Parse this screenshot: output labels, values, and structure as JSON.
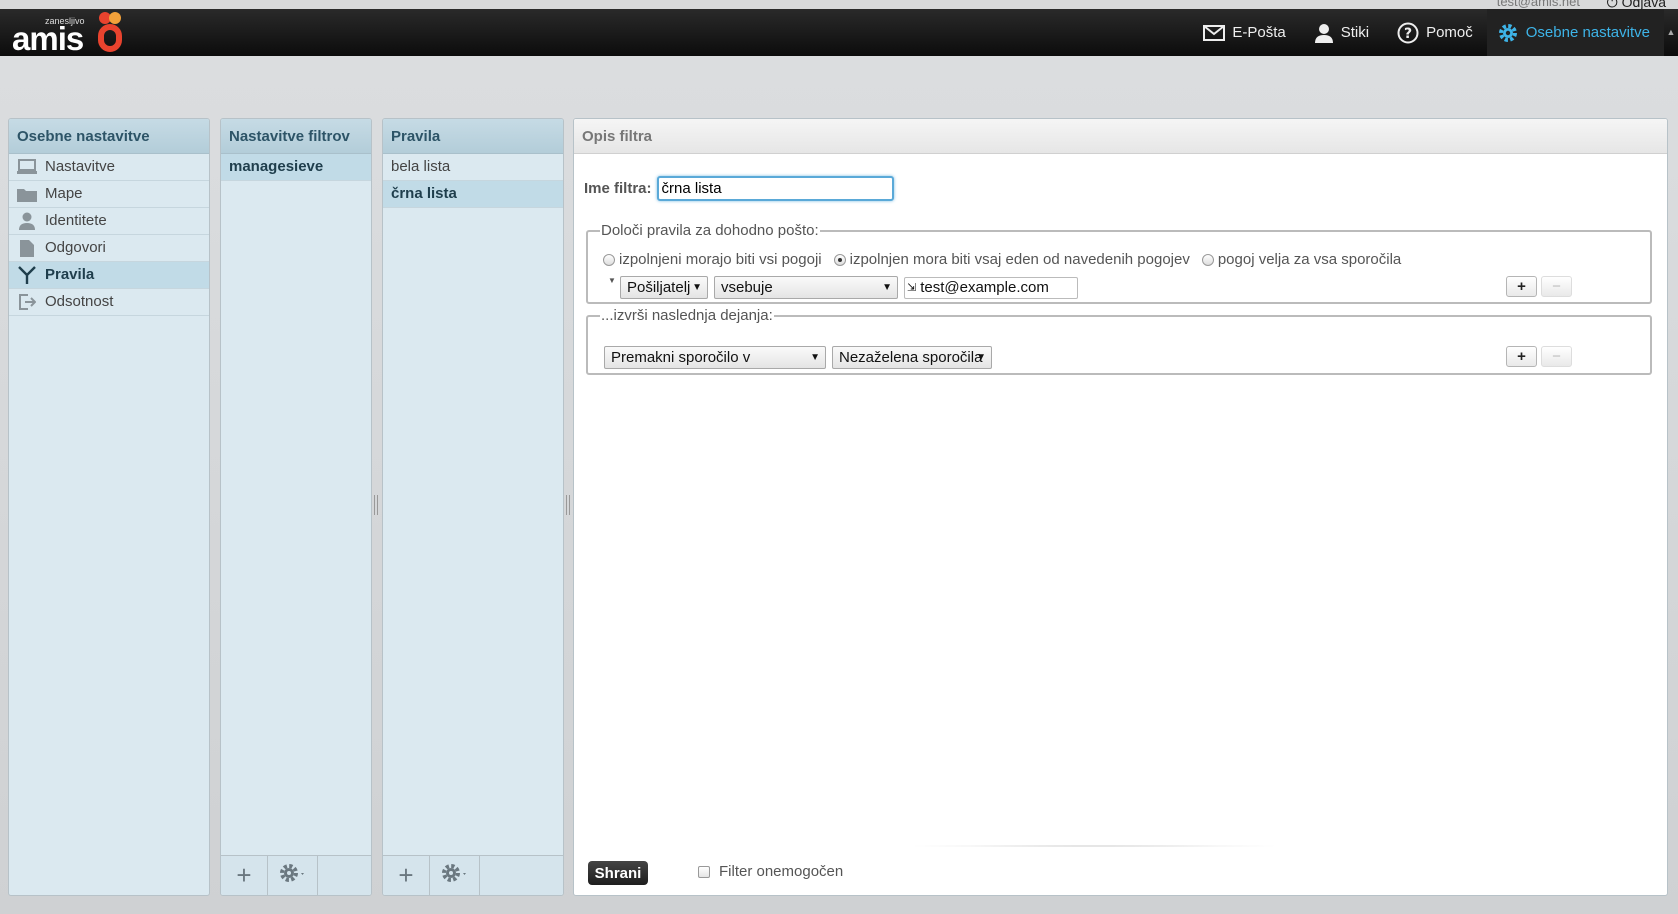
{
  "header": {
    "user_email": "test@amis.net",
    "logout_label": "Odjava",
    "logo": {
      "tagline": "zanesljivo",
      "wordmark": "amis"
    },
    "nav": [
      {
        "label": "E-Pošta",
        "icon": "mail-icon"
      },
      {
        "label": "Stiki",
        "icon": "contact-icon"
      },
      {
        "label": "Pomoč",
        "icon": "help-icon"
      },
      {
        "label": "Osebne nastavitve",
        "icon": "gear-icon",
        "active": true
      }
    ],
    "accent_color": "#3eb4e8"
  },
  "settings_panel": {
    "title": "Osebne nastavitve",
    "items": [
      {
        "label": "Nastavitve",
        "icon": "monitor-icon"
      },
      {
        "label": "Mape",
        "icon": "folder-icon"
      },
      {
        "label": "Identitete",
        "icon": "user-icon"
      },
      {
        "label": "Odgovori",
        "icon": "document-icon"
      },
      {
        "label": "Pravila",
        "icon": "filter-icon",
        "selected": true
      },
      {
        "label": "Odsotnost",
        "icon": "exit-icon"
      }
    ]
  },
  "filter_sets_panel": {
    "title": "Nastavitve filtrov",
    "items": [
      {
        "label": "managesieve",
        "selected": true
      }
    ]
  },
  "rules_panel": {
    "title": "Pravila",
    "items": [
      {
        "label": "bela lista"
      },
      {
        "label": "črna lista",
        "selected": true
      }
    ]
  },
  "filter": {
    "title": "Opis filtra",
    "name_label": "Ime filtra:",
    "name_value": "črna lista",
    "rules_legend": "Določi pravila za dohodno pošto:",
    "match_options": [
      {
        "label": "izpolnjeni morajo biti vsi pogoji",
        "checked": false
      },
      {
        "label": "izpolnjen mora biti vsaj eden od navedenih pogojev",
        "checked": true
      },
      {
        "label": "pogoj velja za vsa sporočila",
        "checked": false
      }
    ],
    "rule": {
      "header": "Pošiljatelj",
      "operator": "vsebuje",
      "value": "test@example.com"
    },
    "actions_legend": "...izvrši naslednja dejanja:",
    "action": {
      "type": "Premakni sporočilo v",
      "target": "Nezaželena sporočila"
    },
    "add_label": "+",
    "remove_label": "−",
    "save_label": "Shrani",
    "disabled_label": "Filter onemogočen"
  }
}
